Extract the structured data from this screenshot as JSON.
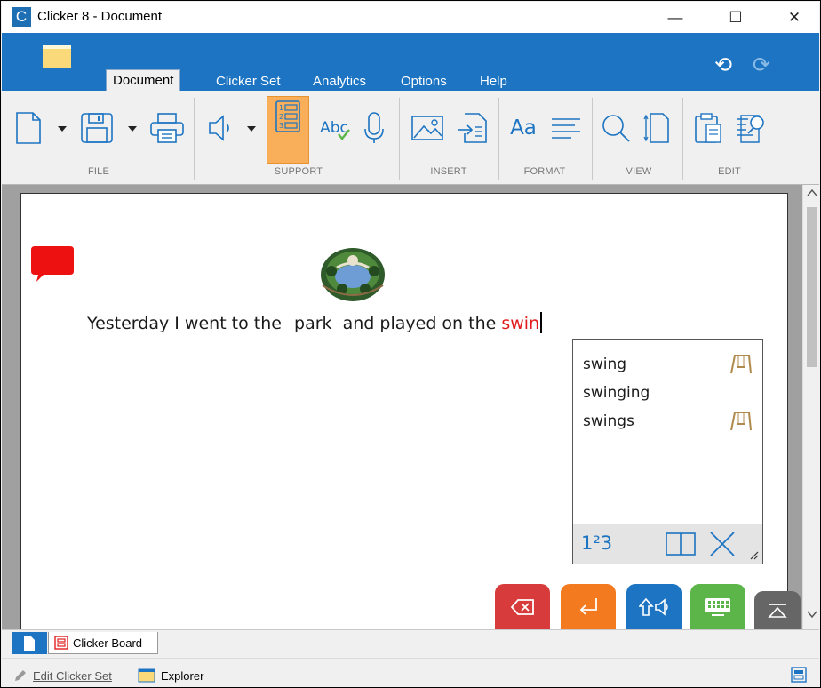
{
  "window": {
    "title": "Clicker 8 - Document",
    "app_letter": "C",
    "minimize": "—",
    "maximize": "☐",
    "close": "✕"
  },
  "tabs": [
    "Document",
    "Clicker Set",
    "Analytics",
    "Options",
    "Help"
  ],
  "ribbon_groups": [
    "FILE",
    "SUPPORT",
    "INSERT",
    "FORMAT",
    "VIEW",
    "EDIT"
  ],
  "ribbon": {
    "spell_label": "Abc",
    "font_label": "Aa",
    "undo": "⟲",
    "redo": "⟳"
  },
  "document": {
    "sentence": [
      "Yesterday I went to the ",
      "park",
      "  and played on the ",
      "swin"
    ]
  },
  "predictions": {
    "items": [
      "swing",
      "swinging",
      "swings"
    ],
    "numbers_label": "1²3"
  },
  "bottom_tabs": {
    "clicker_board": "Clicker Board"
  },
  "status": {
    "edit_set": "Edit Clicker Set",
    "explorer": "Explorer"
  },
  "colors": {
    "accent": "#1d74c2",
    "highlight": "#f9ae5a",
    "misspelled": "#e11b1b",
    "delete_key": "#d83b3b",
    "enter_key": "#f37a1f",
    "shift_key": "#1d74c2",
    "keyboard_key": "#5bb548",
    "collapse_key": "#666666"
  }
}
